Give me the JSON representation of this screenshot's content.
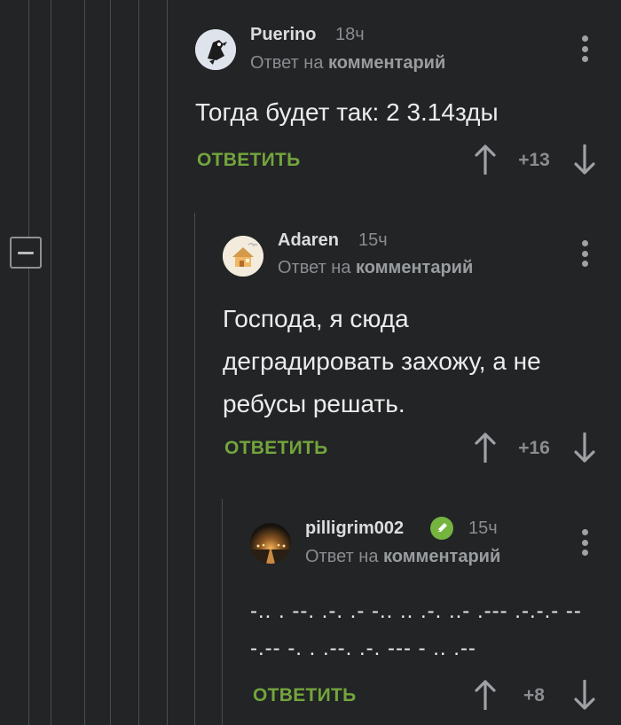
{
  "thread": {
    "collapse_icon": "collapse-minus-icon"
  },
  "comments": [
    {
      "author": "Puerino",
      "time": "18ч",
      "reply_prefix": "Ответ на",
      "reply_link": "комментарий",
      "text": "Тогда будет так: 2 3.14зды",
      "reply_label": "ОТВЕТИТЬ",
      "score": "+13",
      "avatar_icon": "bird-avatar-icon"
    },
    {
      "author": "Adaren",
      "time": "15ч",
      "reply_prefix": "Ответ на",
      "reply_link": "комментарий",
      "text_line1": "Господа, я сюда",
      "text_line2": "деградировать захожу, а не",
      "text_line3": "ребусы решать.",
      "reply_label": "ОТВЕТИТЬ",
      "score": "+16",
      "avatar_icon": "house-avatar-icon"
    },
    {
      "author": "pilligrim002",
      "time": "15ч",
      "reply_prefix": "Ответ на",
      "reply_link": "комментарий",
      "text_line1": "-.. . --. .-. .- -.. .. .-. ..- .--- .-.-.- --",
      "text_line2": "-.-- -. . .--. .-. --- - .. .--",
      "reply_label": "ОТВЕТИТЬ",
      "score": "+8",
      "avatar_icon": "night-road-avatar-icon",
      "badge_icon": "verified-pencil-icon"
    }
  ],
  "colors": {
    "background": "#222426",
    "accent_green": "#73a53c",
    "muted": "#8a8d90"
  }
}
